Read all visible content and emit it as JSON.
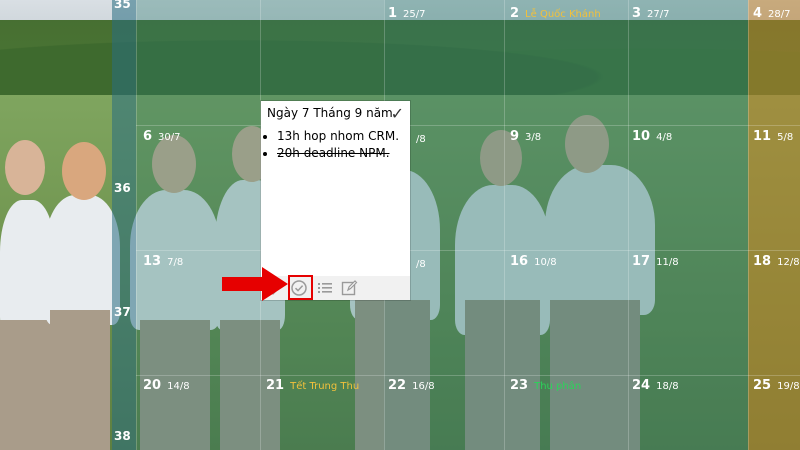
{
  "week_numbers": [
    "35",
    "36",
    "37",
    "38"
  ],
  "rows": [
    [
      {
        "day": "1",
        "lunar": "25/7",
        "holiday": ""
      },
      {
        "day": "2",
        "lunar": "",
        "holiday": "Lễ Quốc Khánh"
      },
      {
        "day": "3",
        "lunar": "27/7",
        "holiday": ""
      },
      {
        "day": "4",
        "lunar": "28/7",
        "holiday": ""
      }
    ],
    [
      {
        "day": "6",
        "lunar": "30/7",
        "holiday": ""
      },
      {
        "day": "",
        "lunar": "/8",
        "holiday": ""
      },
      {
        "day": "9",
        "lunar": "3/8",
        "holiday": ""
      },
      {
        "day": "10",
        "lunar": "4/8",
        "holiday": ""
      },
      {
        "day": "11",
        "lunar": "5/8",
        "holiday": ""
      }
    ],
    [
      {
        "day": "13",
        "lunar": "7/8",
        "holiday": ""
      },
      {
        "day": "",
        "lunar": "/8",
        "holiday": ""
      },
      {
        "day": "16",
        "lunar": "10/8",
        "holiday": ""
      },
      {
        "day": "17",
        "lunar": "11/8",
        "holiday": ""
      },
      {
        "day": "18",
        "lunar": "12/8",
        "holiday": ""
      }
    ],
    [
      {
        "day": "20",
        "lunar": "14/8",
        "holiday": ""
      },
      {
        "day": "21",
        "lunar": "",
        "holiday": "Tết Trung Thu"
      },
      {
        "day": "22",
        "lunar": "16/8",
        "holiday": ""
      },
      {
        "day": "23",
        "lunar": "",
        "holiday": "Thu phân"
      },
      {
        "day": "24",
        "lunar": "18/8",
        "holiday": ""
      },
      {
        "day": "25",
        "lunar": "19/8",
        "holiday": ""
      }
    ]
  ],
  "popup": {
    "title": "Ngày 7 Tháng 9 năm",
    "confirm_icon": "check-icon",
    "notes": [
      {
        "text": "13h hop nhom CRM.",
        "done": false
      },
      {
        "text": "20h deadline NPM.",
        "done": true
      }
    ],
    "toolbar_icons": [
      "diamond-icon",
      "check-circle-icon",
      "list-icon",
      "edit-icon"
    ]
  },
  "colors": {
    "holiday": "#f2c13b",
    "solar_term": "#2bd45a",
    "week_column": "#286e82",
    "highlight": "#e60000"
  }
}
